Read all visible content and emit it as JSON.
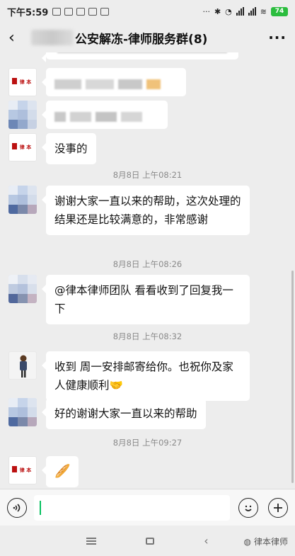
{
  "status_bar": {
    "time": "下午5:59",
    "battery": "74"
  },
  "header": {
    "title": "公安解冻-律师服务群(8)",
    "more": "···"
  },
  "messages": [
    {
      "type": "text",
      "text": "没事的"
    },
    {
      "type": "timestamp",
      "text": "8月8日 上午08:21"
    },
    {
      "type": "text",
      "text": "谢谢大家一直以来的帮助，这次处理的结果还是比较满意的，非常感谢"
    },
    {
      "type": "timestamp",
      "text": "8月8日 上午08:26"
    },
    {
      "type": "text",
      "text": "@律本律师团队  看看收到了回复我一下"
    },
    {
      "type": "timestamp",
      "text": "8月8日 上午08:32"
    },
    {
      "type": "text",
      "text": "收到 周一安排邮寄给你。也祝你及家人健康顺利🤝"
    },
    {
      "type": "text",
      "text": "好的谢谢大家一直以来的帮助"
    },
    {
      "type": "timestamp",
      "text": "8月8日 上午09:27"
    },
    {
      "type": "emoji",
      "text": "🥖"
    }
  ],
  "input": {
    "value": ""
  },
  "watermark": "律本律师",
  "colors": {
    "background": "#ededed",
    "bubble": "#ffffff",
    "caret": "#07c160",
    "timestamp": "#8a8a8a"
  }
}
